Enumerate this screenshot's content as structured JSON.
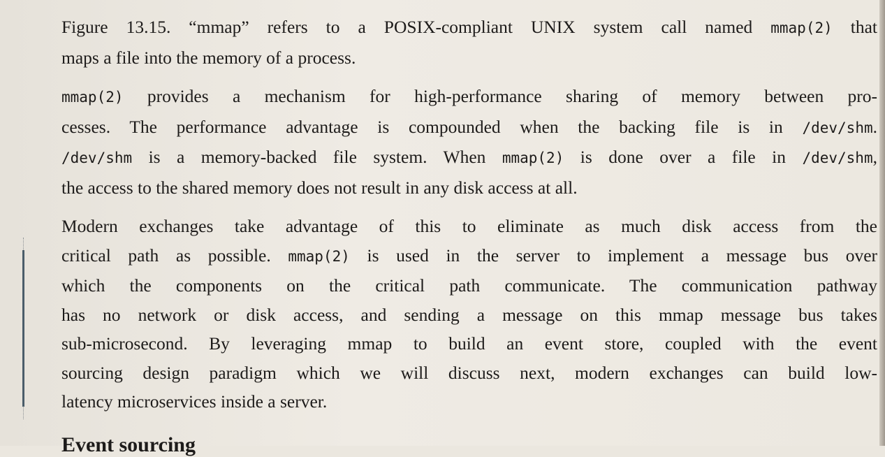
{
  "paragraphs": [
    {
      "lines": [
        [
          {
            "t": "Figure 13.15. “mmap” refers to a POSIX-compliant UNIX system call named "
          },
          {
            "t": "mmap(2)",
            "code": true
          },
          {
            "t": " that"
          }
        ],
        [
          {
            "t": "maps a file into the memory of a process."
          }
        ]
      ]
    },
    {
      "lines": [
        [
          {
            "t": "mmap(2)",
            "code": true
          },
          {
            "t": " provides a mechanism for high-performance sharing of memory between pro-"
          }
        ],
        [
          {
            "t": "cesses. The performance advantage is compounded when the backing file is in "
          },
          {
            "t": "/dev/shm",
            "code": true
          },
          {
            "t": "."
          }
        ],
        [
          {
            "t": "/dev/shm",
            "code": true
          },
          {
            "t": " is a memory-backed file system. When "
          },
          {
            "t": "mmap(2)",
            "code": true
          },
          {
            "t": " is done over a file in "
          },
          {
            "t": "/dev/shm",
            "code": true
          },
          {
            "t": ","
          }
        ],
        [
          {
            "t": "the access to the shared memory does not result in any disk access at all."
          }
        ]
      ]
    },
    {
      "lines": [
        [
          {
            "t": "Modern exchanges take advantage of this to eliminate as much disk access from the"
          }
        ],
        [
          {
            "t": "critical path as possible. "
          },
          {
            "t": "mmap(2)",
            "code": true
          },
          {
            "t": " is used in the server to implement a message bus over"
          }
        ],
        [
          {
            "t": "which the components on the critical path communicate. The communication pathway"
          }
        ],
        [
          {
            "t": "has no network or disk access, and sending a message on this mmap message bus takes"
          }
        ],
        [
          {
            "t": "sub-microsecond. By leveraging mmap to build an event store, coupled with the event"
          }
        ],
        [
          {
            "t": "sourcing design paradigm which we will discuss next, modern exchanges can build low-"
          }
        ],
        [
          {
            "t": "latency microservices inside a server."
          }
        ]
      ]
    }
  ],
  "next_heading_fragment": "Event sourcing"
}
